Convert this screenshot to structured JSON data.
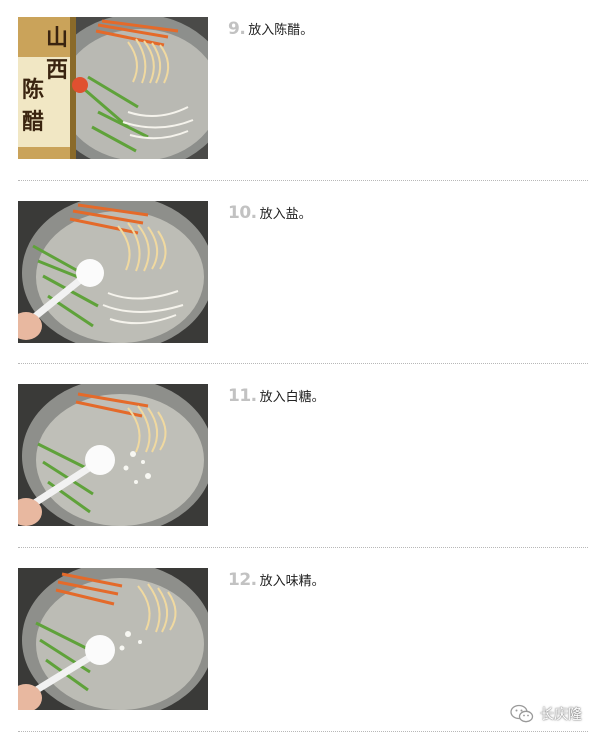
{
  "steps": [
    {
      "number": "9.",
      "text": "放入陈醋。",
      "photo": "vinegar-bottle-and-salad-bowl",
      "bottle_label": [
        "山",
        "西",
        "陈",
        "醋"
      ]
    },
    {
      "number": "10.",
      "text": "放入盐。",
      "photo": "spoon-of-salt-over-salad-bowl"
    },
    {
      "number": "11.",
      "text": "放入白糖。",
      "photo": "spoon-of-sugar-over-salad-bowl"
    },
    {
      "number": "12.",
      "text": "放入味精。",
      "photo": "spoon-of-msg-over-salad-bowl"
    }
  ],
  "watermark": {
    "text": "长庆隆",
    "icon": "wechat-icon"
  },
  "colors": {
    "step_number": "#c2c2c2",
    "step_text": "#222222",
    "divider": "#b8b8b8"
  }
}
